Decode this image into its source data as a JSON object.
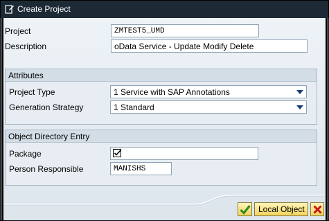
{
  "window": {
    "title": "Create Project"
  },
  "project": {
    "label": "Project",
    "value": "ZMTEST5_UMD"
  },
  "description": {
    "label": "Description",
    "value": "oData Service - Update Modify Delete"
  },
  "attributes": {
    "title": "Attributes",
    "project_type": {
      "label": "Project Type",
      "value": "1 Service with SAP Annotations"
    },
    "generation_strategy": {
      "label": "Generation Strategy",
      "value": "1 Standard"
    }
  },
  "object_directory": {
    "title": "Object Directory Entry",
    "package": {
      "label": "Package",
      "checked": true
    },
    "person": {
      "label": "Person Responsible",
      "value": "MANISHS"
    }
  },
  "buttons": {
    "confirm_icon": "checkmark-icon",
    "local_object": "Local Object",
    "cancel_icon": "cancel-x-icon"
  },
  "colors": {
    "titlebar": "#1d2a36",
    "button": "#f2d35c",
    "cancel": "#cc1111",
    "confirm": "#2a8a1f"
  }
}
